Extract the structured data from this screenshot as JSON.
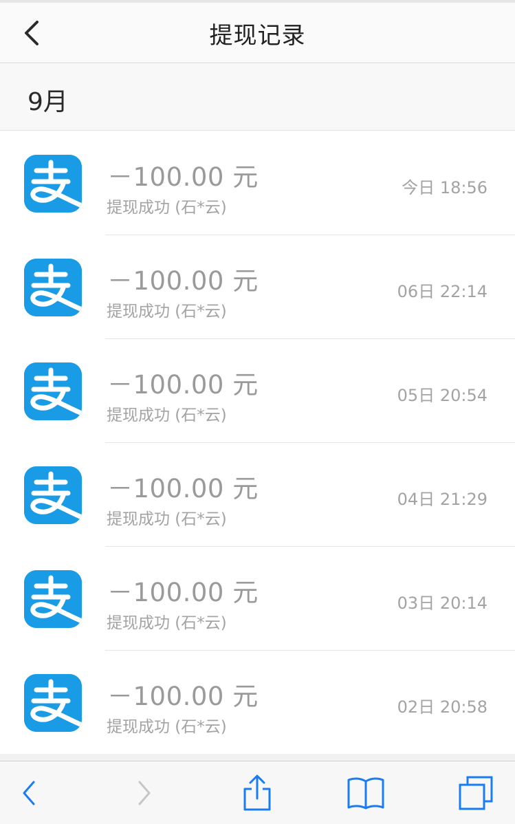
{
  "header": {
    "title": "提现记录",
    "back_icon": "chevron-left-icon"
  },
  "month": {
    "label": "9月"
  },
  "records": [
    {
      "amount": "－100.00 元",
      "status": "提现成功 (石*云)",
      "time": "今日 18:56"
    },
    {
      "amount": "－100.00 元",
      "status": "提现成功 (石*云)",
      "time": "06日 22:14"
    },
    {
      "amount": "－100.00 元",
      "status": "提现成功 (石*云)",
      "time": "05日 20:54"
    },
    {
      "amount": "－100.00 元",
      "status": "提现成功 (石*云)",
      "time": "04日 21:29"
    },
    {
      "amount": "－100.00 元",
      "status": "提现成功 (石*云)",
      "time": "03日 20:14"
    },
    {
      "amount": "－100.00 元",
      "status": "提现成功 (石*云)",
      "time": "02日 20:58"
    }
  ],
  "toolbar": {
    "back_icon": "browser-back-icon",
    "forward_icon": "browser-forward-icon",
    "share_icon": "share-icon",
    "bookmarks_icon": "bookmarks-icon",
    "tabs_icon": "tabs-icon"
  },
  "colors": {
    "alipay_blue": "#1a9be6",
    "ios_blue": "#1a7cf2",
    "disabled_gray": "#c6c6c8"
  }
}
